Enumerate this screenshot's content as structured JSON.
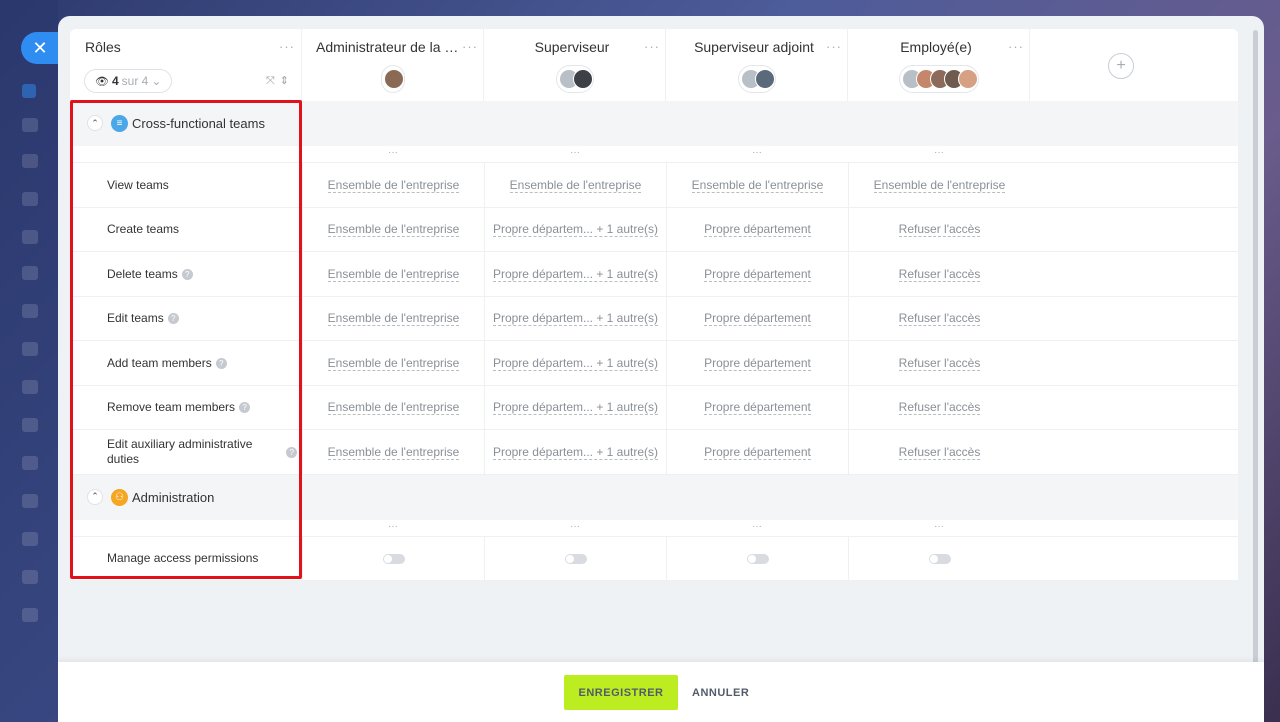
{
  "window": {
    "close_icon": "close-icon"
  },
  "roles_header": {
    "title": "Rôles",
    "counter_selected": "4",
    "counter_of": "sur 4",
    "menu": "···"
  },
  "roles": [
    {
      "name": "Administrateur de la s…",
      "avatars": [
        "#8a6a55"
      ]
    },
    {
      "name": "Superviseur",
      "avatars": [
        "#b9bfc7",
        "#3d4147"
      ]
    },
    {
      "name": "Superviseur adjoint",
      "avatars": [
        "#b9bfc7",
        "#5a6a7a"
      ]
    },
    {
      "name": "Employé(e)",
      "avatars": [
        "#b9bfc7",
        "#c4876b",
        "#8d6b5a",
        "#6e5a4e",
        "#d6a084"
      ]
    }
  ],
  "sections": [
    {
      "title": "Cross-functional teams",
      "icon": "teams-icon",
      "icon_color": "#4aa8e8",
      "rows": [
        {
          "label": "View teams",
          "help": false,
          "values": [
            "Ensemble de l'entreprise",
            "Ensemble de l'entreprise",
            "Ensemble de l'entreprise",
            "Ensemble de l'entreprise"
          ]
        },
        {
          "label": "Create teams",
          "help": false,
          "values": [
            "Ensemble de l'entreprise",
            "Propre départem... + 1 autre(s)",
            "Propre département",
            "Refuser l'accès"
          ]
        },
        {
          "label": "Delete teams",
          "help": true,
          "values": [
            "Ensemble de l'entreprise",
            "Propre départem... + 1 autre(s)",
            "Propre département",
            "Refuser l'accès"
          ]
        },
        {
          "label": "Edit teams",
          "help": true,
          "values": [
            "Ensemble de l'entreprise",
            "Propre départem... + 1 autre(s)",
            "Propre département",
            "Refuser l'accès"
          ]
        },
        {
          "label": "Add team members",
          "help": true,
          "values": [
            "Ensemble de l'entreprise",
            "Propre départem... + 1 autre(s)",
            "Propre département",
            "Refuser l'accès"
          ]
        },
        {
          "label": "Remove team members",
          "help": true,
          "values": [
            "Ensemble de l'entreprise",
            "Propre départem... + 1 autre(s)",
            "Propre département",
            "Refuser l'accès"
          ]
        },
        {
          "label": "Edit auxiliary administrative duties",
          "help": true,
          "values": [
            "Ensemble de l'entreprise",
            "Propre départem... + 1 autre(s)",
            "Propre département",
            "Refuser l'accès"
          ]
        }
      ]
    },
    {
      "title": "Administration",
      "icon": "administration-icon",
      "icon_color": "#f5a623",
      "rows": [
        {
          "label": "Manage access permissions",
          "help": false,
          "toggle": true,
          "toggle_on": [
            false,
            false,
            false,
            false
          ]
        }
      ]
    }
  ],
  "footer": {
    "save_label": "ENREGISTRER",
    "cancel_label": "ANNULER"
  },
  "colors": {
    "accent": "#2f8cf1",
    "save": "#bbed21",
    "highlight": "#e2121a"
  }
}
